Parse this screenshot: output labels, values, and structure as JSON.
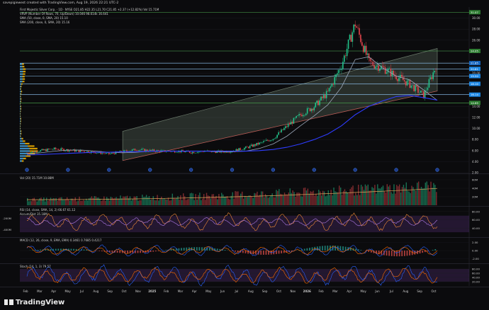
{
  "caption": "savepigiewest created with TradingView.com, Aug 19, 2026 22:21 UTC-2",
  "brand": "TradingView",
  "colors": {
    "bg": "#0b0b0d",
    "grid": "#1c1c22",
    "text": "#cfcfcf",
    "up": "#22c28a",
    "down": "#e0454b",
    "sma50": "#9aa6b8",
    "sma200": "#2e3cff",
    "channel": "#6b7a6b",
    "hline": "#4caf50",
    "vp_up": "#1e88e5",
    "vp_down": "#f5b300"
  },
  "legends": {
    "main": [
      "First Majestic Silver Corp. · 1D · NYSE  O21.85 H22.35 L21.70 C21.85 +2.37 (+12.82%)  Vol 15.71M",
      "VRVP (Number Of Rows, 70, Up/Down)  10.046  98.614k  16.641",
      "SMA (50, close, 0, SMA, 20)  15.10",
      "SMA (200, close, 0, SMA, 20)  15.16"
    ],
    "vol": "Vol (20)  15.71M  10.88M",
    "rsi": "RSI (14, close, SMA, 14, 2)  66.67  61.12",
    "rsi2": "Accum/Dist  35.18M",
    "macd": "MACD (12, 26, close, 9, EMA, EMA)  0.3461  0.7685  0.4217",
    "stoch": "Stoch (14, 1, 3)  79  57"
  },
  "chart_data": [
    {
      "type": "candlestick",
      "pane": "price",
      "title": "First Majestic Silver Corp. · 1D · NYSE",
      "xlabel": "",
      "ylabel": "",
      "x": [
        "2024-02",
        "2024-03",
        "2024-04",
        "2024-05",
        "2024-06",
        "2024-07",
        "2024-08",
        "2024-09",
        "2024-10",
        "2024-11",
        "2024-12",
        "2025-01",
        "2025-02",
        "2025-03",
        "2025-04",
        "2025-05",
        "2025-06",
        "2025-07",
        "2025-08",
        "2025-09",
        "2025-10",
        "2025-11",
        "2025-12",
        "2026-01",
        "2026-02",
        "2026-03",
        "2026-04",
        "2026-05",
        "2026-06",
        "2026-07",
        "2026-08"
      ],
      "close": [
        5.6,
        6.0,
        6.3,
        6.1,
        5.9,
        5.7,
        5.4,
        5.8,
        6.2,
        6.0,
        5.9,
        5.9,
        5.7,
        5.9,
        5.8,
        5.9,
        6.5,
        7.3,
        8.2,
        10.4,
        12.5,
        14.0,
        16.5,
        21.5,
        29.0,
        22.0,
        21.0,
        19.5,
        18.0,
        16.0,
        21.85
      ],
      "sma50": [
        5.4,
        5.6,
        5.9,
        6.1,
        6.1,
        5.9,
        5.7,
        5.6,
        5.7,
        5.9,
        5.9,
        5.9,
        5.9,
        5.9,
        5.8,
        5.8,
        5.9,
        6.4,
        7.2,
        8.6,
        10.5,
        12.3,
        14.3,
        17.5,
        22.5,
        23.0,
        21.0,
        19.5,
        18.8,
        17.0,
        15.1
      ],
      "sma200": [
        5.2,
        5.3,
        5.4,
        5.5,
        5.6,
        5.7,
        5.7,
        5.8,
        5.8,
        5.9,
        5.9,
        5.9,
        5.9,
        5.9,
        5.9,
        5.9,
        5.9,
        6.0,
        6.2,
        6.6,
        7.2,
        8.0,
        9.0,
        10.5,
        12.5,
        14.0,
        15.0,
        15.8,
        16.0,
        15.6,
        15.16
      ],
      "ylim": [
        2,
        32
      ],
      "yticks": [
        2.0,
        4.0,
        6.0,
        8.0,
        10.0,
        12.0,
        14.0,
        16.0,
        18.0,
        20.0,
        22.0,
        24.0,
        26.0,
        28.0,
        30.0
      ],
      "price_levels": [
        {
          "value": 31.07,
          "label": "31.07",
          "color": "#2e7d32"
        },
        {
          "value": 24.05,
          "label": "24.05",
          "color": "#2e7d32"
        },
        {
          "value": 21.85,
          "label": "21.85",
          "color": "#1565c0"
        },
        {
          "value": 20.81,
          "label": "20.81",
          "color": "#1e88e5"
        },
        {
          "value": 19.5,
          "label": "19.50",
          "color": "#1e88e5"
        },
        {
          "value": 18.1,
          "label": "18.10",
          "color": "#1e88e5"
        },
        {
          "value": 16.14,
          "label": "16.14",
          "color": "#1e88e5"
        },
        {
          "value": 14.65,
          "label": "14.65",
          "color": "#2e7d32"
        }
      ],
      "channel": {
        "start": [
          "2024-09",
          4.2,
          9.5
        ],
        "end": [
          "2026-08",
          16.8,
          24.5
        ]
      },
      "xticks": [
        "Feb",
        "Mar",
        "Apr",
        "May",
        "Jul",
        "Aug",
        "Sep",
        "Oct",
        "Nov",
        "2025",
        "Feb",
        "Mar",
        "Apr",
        "May",
        "Jun",
        "Jul",
        "Aug",
        "Sep",
        "Oct",
        "Nov",
        "2026",
        "Feb",
        "Mar",
        "Apr",
        "May",
        "Jun",
        "Jul",
        "Aug",
        "Sep",
        "Oct"
      ]
    },
    {
      "type": "bar",
      "pane": "volume",
      "yticks": [
        "60M",
        "40M",
        "20M"
      ],
      "ylim": [
        0,
        70
      ]
    },
    {
      "type": "line",
      "pane": "rsi",
      "yticks": [
        "80.00",
        "60.00",
        "40.00"
      ],
      "left_ticks": [
        "-200M",
        "-400M"
      ],
      "ylim": [
        20,
        90
      ],
      "bands": [
        30,
        70
      ]
    },
    {
      "type": "line",
      "pane": "macd",
      "yticks": [
        "2.00",
        "0.00",
        "-2.00"
      ],
      "ylim": [
        -3,
        3
      ]
    },
    {
      "type": "line",
      "pane": "stoch",
      "yticks": [
        "80.00",
        "60.00",
        "40.00",
        "20.00"
      ],
      "ylim": [
        0,
        100
      ],
      "bands": [
        20,
        80
      ]
    }
  ]
}
